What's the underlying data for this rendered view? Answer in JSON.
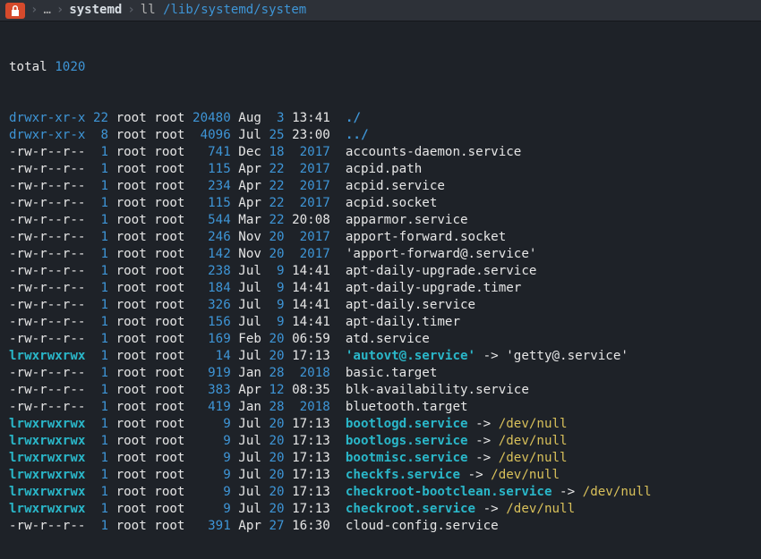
{
  "titlebar": {
    "lock_glyph": "🔒",
    "sep": "›",
    "ellipsis": "…",
    "folder": "systemd",
    "cmd_plain": "ll ",
    "cmd_path": "/lib/systemd/system"
  },
  "total_label": "total ",
  "total_value": "1020",
  "rows": [
    {
      "perms": "drwxr-xr-x",
      "links": "22",
      "owner": "root",
      "group": "root",
      "size": "20480",
      "mon": "Aug",
      "day": " 3",
      "time": "13:41",
      "name": [
        {
          "t": "./",
          "c": "c-dir"
        }
      ]
    },
    {
      "perms": "drwxr-xr-x",
      "links": " 8",
      "owner": "root",
      "group": "root",
      "size": "4096",
      "mon": "Jul",
      "day": "25",
      "time": "23:00",
      "name": [
        {
          "t": "../",
          "c": "c-dir"
        }
      ]
    },
    {
      "perms": "-rw-r--r--",
      "links": " 1",
      "owner": "root",
      "group": "root",
      "size": "741",
      "mon": "Dec",
      "day": "18",
      "time": " 2017",
      "name": [
        {
          "t": "accounts-daemon.service",
          "c": "c-white"
        }
      ]
    },
    {
      "perms": "-rw-r--r--",
      "links": " 1",
      "owner": "root",
      "group": "root",
      "size": "115",
      "mon": "Apr",
      "day": "22",
      "time": " 2017",
      "name": [
        {
          "t": "acpid.path",
          "c": "c-white"
        }
      ]
    },
    {
      "perms": "-rw-r--r--",
      "links": " 1",
      "owner": "root",
      "group": "root",
      "size": "234",
      "mon": "Apr",
      "day": "22",
      "time": " 2017",
      "name": [
        {
          "t": "acpid.service",
          "c": "c-white"
        }
      ]
    },
    {
      "perms": "-rw-r--r--",
      "links": " 1",
      "owner": "root",
      "group": "root",
      "size": "115",
      "mon": "Apr",
      "day": "22",
      "time": " 2017",
      "name": [
        {
          "t": "acpid.socket",
          "c": "c-white"
        }
      ]
    },
    {
      "perms": "-rw-r--r--",
      "links": " 1",
      "owner": "root",
      "group": "root",
      "size": "544",
      "mon": "Mar",
      "day": "22",
      "time": "20:08",
      "name": [
        {
          "t": "apparmor.service",
          "c": "c-white"
        }
      ]
    },
    {
      "perms": "-rw-r--r--",
      "links": " 1",
      "owner": "root",
      "group": "root",
      "size": "246",
      "mon": "Nov",
      "day": "20",
      "time": " 2017",
      "name": [
        {
          "t": "apport-forward.socket",
          "c": "c-white"
        }
      ]
    },
    {
      "perms": "-rw-r--r--",
      "links": " 1",
      "owner": "root",
      "group": "root",
      "size": "142",
      "mon": "Nov",
      "day": "20",
      "time": " 2017",
      "name": [
        {
          "t": "'apport-forward@.service'",
          "c": "c-white"
        }
      ]
    },
    {
      "perms": "-rw-r--r--",
      "links": " 1",
      "owner": "root",
      "group": "root",
      "size": "238",
      "mon": "Jul",
      "day": " 9",
      "time": "14:41",
      "name": [
        {
          "t": "apt-daily-upgrade.service",
          "c": "c-white"
        }
      ]
    },
    {
      "perms": "-rw-r--r--",
      "links": " 1",
      "owner": "root",
      "group": "root",
      "size": "184",
      "mon": "Jul",
      "day": " 9",
      "time": "14:41",
      "name": [
        {
          "t": "apt-daily-upgrade.timer",
          "c": "c-white"
        }
      ]
    },
    {
      "perms": "-rw-r--r--",
      "links": " 1",
      "owner": "root",
      "group": "root",
      "size": "326",
      "mon": "Jul",
      "day": " 9",
      "time": "14:41",
      "name": [
        {
          "t": "apt-daily.service",
          "c": "c-white"
        }
      ]
    },
    {
      "perms": "-rw-r--r--",
      "links": " 1",
      "owner": "root",
      "group": "root",
      "size": "156",
      "mon": "Jul",
      "day": " 9",
      "time": "14:41",
      "name": [
        {
          "t": "apt-daily.timer",
          "c": "c-white"
        }
      ]
    },
    {
      "perms": "-rw-r--r--",
      "links": " 1",
      "owner": "root",
      "group": "root",
      "size": "169",
      "mon": "Feb",
      "day": "20",
      "time": "06:59",
      "name": [
        {
          "t": "atd.service",
          "c": "c-white"
        }
      ]
    },
    {
      "perms": "lrwxrwxrwx",
      "links": " 1",
      "owner": "root",
      "group": "root",
      "size": "14",
      "mon": "Jul",
      "day": "20",
      "time": "17:13",
      "name": [
        {
          "t": "'autovt@.service'",
          "c": "c-cyan"
        },
        {
          "t": " -> ",
          "c": "c-white"
        },
        {
          "t": "'getty@.service'",
          "c": "c-white"
        }
      ]
    },
    {
      "perms": "-rw-r--r--",
      "links": " 1",
      "owner": "root",
      "group": "root",
      "size": "919",
      "mon": "Jan",
      "day": "28",
      "time": " 2018",
      "name": [
        {
          "t": "basic.target",
          "c": "c-white"
        }
      ]
    },
    {
      "perms": "-rw-r--r--",
      "links": " 1",
      "owner": "root",
      "group": "root",
      "size": "383",
      "mon": "Apr",
      "day": "12",
      "time": "08:35",
      "name": [
        {
          "t": "blk-availability.service",
          "c": "c-white"
        }
      ]
    },
    {
      "perms": "-rw-r--r--",
      "links": " 1",
      "owner": "root",
      "group": "root",
      "size": "419",
      "mon": "Jan",
      "day": "28",
      "time": " 2018",
      "name": [
        {
          "t": "bluetooth.target",
          "c": "c-white"
        }
      ]
    },
    {
      "perms": "lrwxrwxrwx",
      "links": " 1",
      "owner": "root",
      "group": "root",
      "size": "9",
      "mon": "Jul",
      "day": "20",
      "time": "17:13",
      "name": [
        {
          "t": "bootlogd.service",
          "c": "c-cyan"
        },
        {
          "t": " -> ",
          "c": "c-white"
        },
        {
          "t": "/dev/null",
          "c": "c-yell"
        }
      ]
    },
    {
      "perms": "lrwxrwxrwx",
      "links": " 1",
      "owner": "root",
      "group": "root",
      "size": "9",
      "mon": "Jul",
      "day": "20",
      "time": "17:13",
      "name": [
        {
          "t": "bootlogs.service",
          "c": "c-cyan"
        },
        {
          "t": " -> ",
          "c": "c-white"
        },
        {
          "t": "/dev/null",
          "c": "c-yell"
        }
      ]
    },
    {
      "perms": "lrwxrwxrwx",
      "links": " 1",
      "owner": "root",
      "group": "root",
      "size": "9",
      "mon": "Jul",
      "day": "20",
      "time": "17:13",
      "name": [
        {
          "t": "bootmisc.service",
          "c": "c-cyan"
        },
        {
          "t": " -> ",
          "c": "c-white"
        },
        {
          "t": "/dev/null",
          "c": "c-yell"
        }
      ]
    },
    {
      "perms": "lrwxrwxrwx",
      "links": " 1",
      "owner": "root",
      "group": "root",
      "size": "9",
      "mon": "Jul",
      "day": "20",
      "time": "17:13",
      "name": [
        {
          "t": "checkfs.service",
          "c": "c-cyan"
        },
        {
          "t": " -> ",
          "c": "c-white"
        },
        {
          "t": "/dev/null",
          "c": "c-yell"
        }
      ]
    },
    {
      "perms": "lrwxrwxrwx",
      "links": " 1",
      "owner": "root",
      "group": "root",
      "size": "9",
      "mon": "Jul",
      "day": "20",
      "time": "17:13",
      "name": [
        {
          "t": "checkroot-bootclean.service",
          "c": "c-cyan"
        },
        {
          "t": " -> ",
          "c": "c-white"
        },
        {
          "t": "/dev/null",
          "c": "c-yell"
        }
      ]
    },
    {
      "perms": "lrwxrwxrwx",
      "links": " 1",
      "owner": "root",
      "group": "root",
      "size": "9",
      "mon": "Jul",
      "day": "20",
      "time": "17:13",
      "name": [
        {
          "t": "checkroot.service",
          "c": "c-cyan"
        },
        {
          "t": " -> ",
          "c": "c-white"
        },
        {
          "t": "/dev/null",
          "c": "c-yell"
        }
      ]
    },
    {
      "perms": "-rw-r--r--",
      "links": " 1",
      "owner": "root",
      "group": "root",
      "size": "391",
      "mon": "Apr",
      "day": "27",
      "time": "16:30",
      "name": [
        {
          "t": "cloud-config.service",
          "c": "c-white"
        }
      ]
    }
  ]
}
